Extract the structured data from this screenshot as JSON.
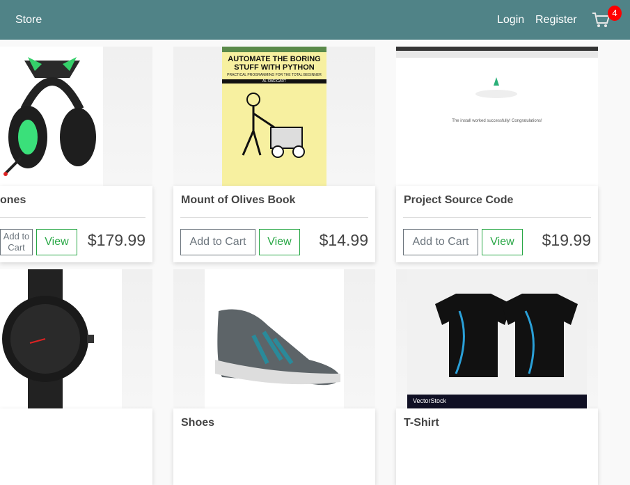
{
  "nav": {
    "brand": "Store",
    "login": "Login",
    "register": "Register",
    "cart_count": "4",
    "badge_color": "#ff0000",
    "bar_color": "#508387"
  },
  "products": [
    {
      "title": "ones",
      "price": "$179.99",
      "add": "Add to Cart",
      "view": "View"
    },
    {
      "title": "Mount of Olives Book",
      "price": "$14.99",
      "add": "Add to Cart",
      "view": "View",
      "cover": {
        "title": "AUTOMATE THE BORING STUFF WITH PYTHON",
        "subtitle": "PRACTICAL PROGRAMMING FOR THE TOTAL BEGINNER",
        "author": "AL SWEIGART"
      }
    },
    {
      "title": "Project Source Code",
      "price": "$19.99",
      "add": "Add to Cart",
      "view": "View",
      "screen_text": "The install worked successfully! Congratulations!"
    },
    {
      "title": ""
    },
    {
      "title": "Shoes"
    },
    {
      "title": "T-Shirt",
      "watermark": "VectorStock"
    }
  ]
}
